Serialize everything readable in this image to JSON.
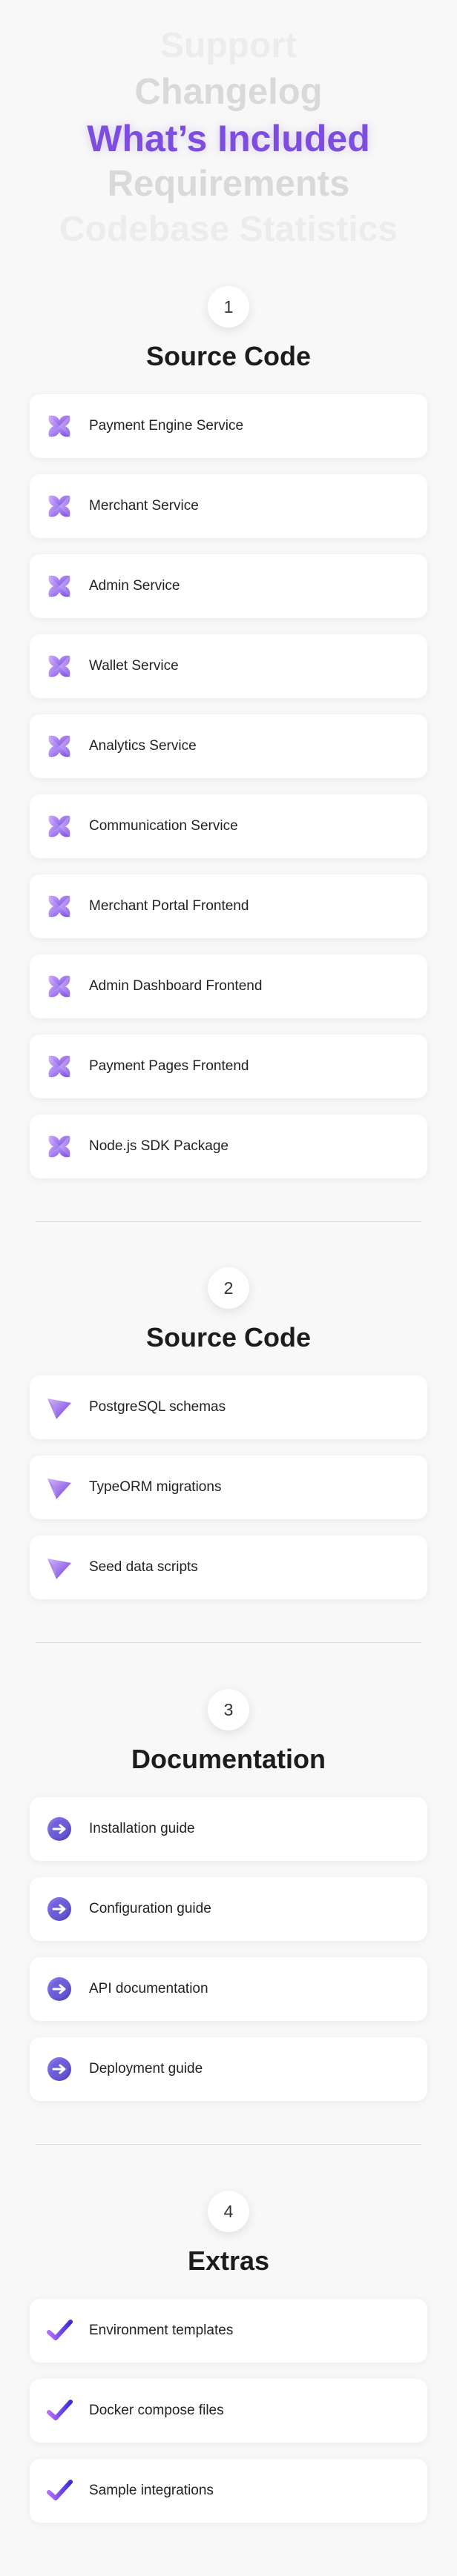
{
  "picker": {
    "items": [
      "Support",
      "Changelog",
      "What’s Included",
      "Requirements",
      "Codebase Statistics"
    ],
    "active_color": "#7c4ddf"
  },
  "sections": [
    {
      "number": "1",
      "title": "Source Code",
      "icon": "purple-flower-icon",
      "items": [
        "Payment Engine Service",
        "Merchant Service",
        "Admin Service",
        "Wallet Service",
        "Analytics Service",
        "Communication Service",
        "Merchant Portal Frontend",
        "Admin Dashboard Frontend",
        "Payment Pages Frontend",
        "Node.js SDK Package"
      ]
    },
    {
      "number": "2",
      "title": "Source Code",
      "icon": "paper-plane-icon",
      "items": [
        "PostgreSQL schemas",
        "TypeORM migrations",
        "Seed data scripts"
      ]
    },
    {
      "number": "3",
      "title": "Documentation",
      "icon": "arrow-circle-icon",
      "items": [
        "Installation guide",
        "Configuration guide",
        "API documentation",
        "Deployment guide"
      ]
    },
    {
      "number": "4",
      "title": "Extras",
      "icon": "checkmark-icon",
      "items": [
        "Environment templates",
        "Docker compose files",
        "Sample integrations"
      ]
    }
  ]
}
